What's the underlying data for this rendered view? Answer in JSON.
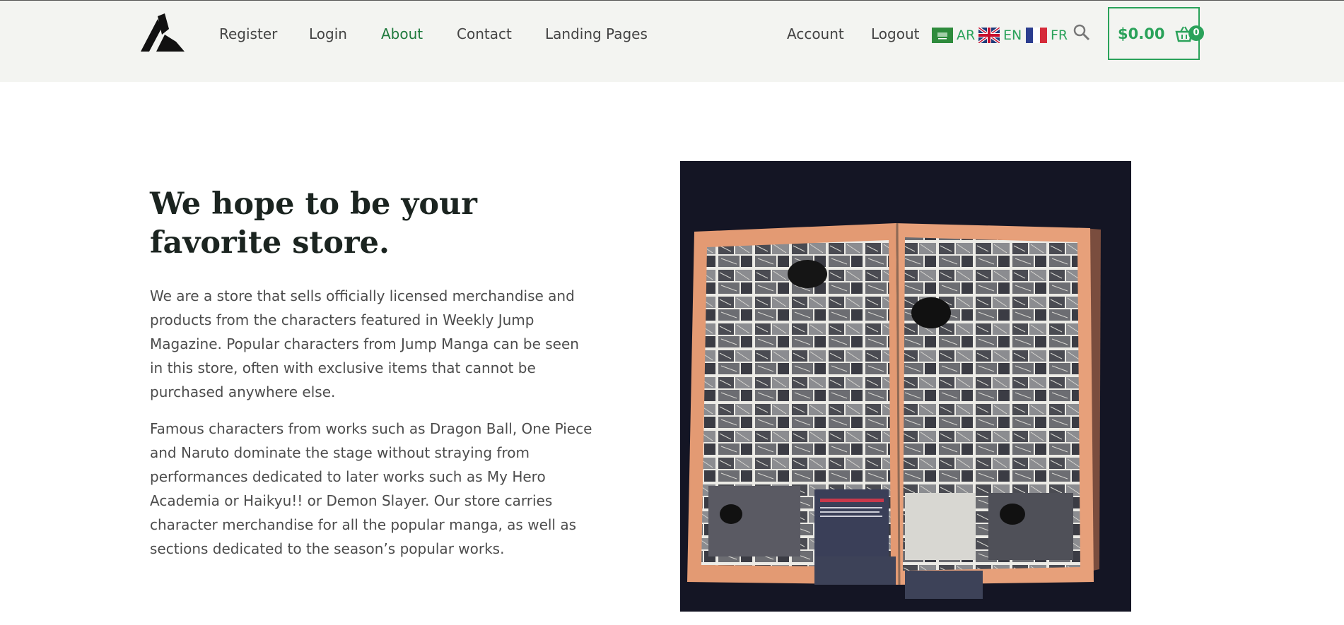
{
  "header": {
    "nav_left": [
      "Register",
      "Login",
      "About",
      "Contact",
      "Landing Pages"
    ],
    "nav_right": [
      "Account",
      "Logout"
    ],
    "languages": [
      {
        "code": "AR",
        "flag": "saudi-flag-icon"
      },
      {
        "code": "EN",
        "flag": "uk-flag-icon"
      },
      {
        "code": "FR",
        "flag": "france-flag-icon"
      }
    ],
    "cart": {
      "total": "$0.00",
      "count": "0"
    }
  },
  "content": {
    "headline": "We hope to be your favorite store.",
    "paragraph_1": "We are a store that sells officially licensed merchandise and products from the characters featured in Weekly Jump Magazine. Popular characters from Jump Manga can be seen in this store, often with exclusive items that cannot be purchased anywhere else.",
    "paragraph_2": "Famous characters from works such as Dragon Ball, One Piece and Naruto dominate the stage without straying from performances dedicated to later works such as My Hero Academia or Haikyu!! or Demon Slayer. Our store carries character merchandise for all the popular manga, as well as sections dedicated to the season’s popular works."
  },
  "colors": {
    "accent": "#2aa25a",
    "active_nav": "#1f7a3d",
    "header_bg": "#f3f4f1"
  }
}
